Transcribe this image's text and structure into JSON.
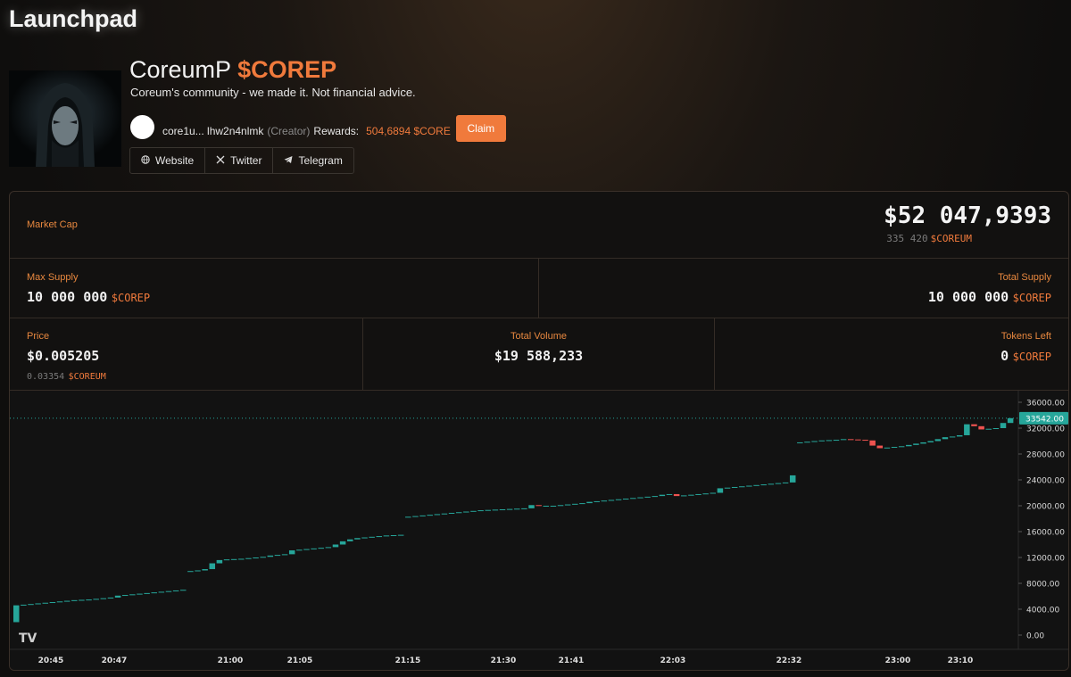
{
  "app": {
    "title": "Launchpad"
  },
  "token": {
    "name": "CoreumP",
    "ticker": "$COREP",
    "description": "Coreum's community - we made it. Not financial advice.",
    "creator_address": "core1u... lhw2n4nlmk",
    "creator_role": "(Creator)",
    "rewards_label": "Rewards:",
    "rewards_value": "504,6894 $CORE",
    "claim_label": "Claim"
  },
  "links": [
    {
      "label": "Website",
      "icon": "globe-icon"
    },
    {
      "label": "Twitter",
      "icon": "x-icon"
    },
    {
      "label": "Telegram",
      "icon": "telegram-icon"
    }
  ],
  "stats": {
    "market_cap_label": "Market Cap",
    "market_cap_value": "$52 047,9393",
    "market_cap_core_amount": "335 420",
    "market_cap_core_unit": "$COREUM",
    "max_supply_label": "Max Supply",
    "max_supply_value": "10 000 000",
    "max_supply_unit": "$COREP",
    "total_supply_label": "Total Supply",
    "total_supply_value": "10 000 000",
    "total_supply_unit": "$COREP",
    "price_label": "Price",
    "price_value": "$0.005205",
    "price_core_amount": "0.03354",
    "price_core_unit": "$COREUM",
    "volume_label": "Total Volume",
    "volume_value": "$19 588,233",
    "tokens_left_label": "Tokens Left",
    "tokens_left_value": "0",
    "tokens_left_unit": "$COREP"
  },
  "colors": {
    "accent": "#f07a3c",
    "label": "#e8883f",
    "up": "#26a69a",
    "down": "#ef5350"
  },
  "chart_data": {
    "type": "candlestick",
    "x": [
      "20:45",
      "20:47",
      "21:00",
      "21:05",
      "21:15",
      "21:30",
      "21:41",
      "22:03",
      "22:32",
      "23:00",
      "23:10"
    ],
    "y_ticks": [
      "36000.00",
      "32000.00",
      "28000.00",
      "24000.00",
      "20000.00",
      "16000.00",
      "12000.00",
      "8000.00",
      "4000.00",
      "0.00"
    ],
    "ylim": [
      0,
      36000
    ],
    "last_price_label": "33542.00",
    "last_price": 33542,
    "watermark": "TV",
    "candles": [
      [
        2000,
        4600,
        "up"
      ],
      [
        4600,
        4700
      ],
      [
        4700,
        4800
      ],
      [
        4800,
        4900
      ],
      [
        4900,
        5000
      ],
      [
        5000,
        5100
      ],
      [
        5100,
        5200
      ],
      [
        5200,
        5300
      ],
      [
        5300,
        5400
      ],
      [
        5400,
        5450
      ],
      [
        5450,
        5500
      ],
      [
        5500,
        5600
      ],
      [
        5600,
        5700
      ],
      [
        5700,
        5800
      ],
      [
        5800,
        6100
      ],
      [
        6100,
        6200
      ],
      [
        6200,
        6300
      ],
      [
        6300,
        6400
      ],
      [
        6400,
        6500
      ],
      [
        6500,
        6600
      ],
      [
        6600,
        6700
      ],
      [
        6700,
        6800
      ],
      [
        6800,
        6900
      ],
      [
        6900,
        7000
      ],
      [
        9800,
        9900
      ],
      [
        9900,
        10000
      ],
      [
        10000,
        10200
      ],
      [
        10200,
        11100
      ],
      [
        11100,
        11600
      ],
      [
        11600,
        11700
      ],
      [
        11700,
        11750
      ],
      [
        11750,
        11800
      ],
      [
        11800,
        11900
      ],
      [
        11900,
        12000
      ],
      [
        12000,
        12100
      ],
      [
        12100,
        12300
      ],
      [
        12300,
        12400
      ],
      [
        12400,
        12500
      ],
      [
        12500,
        13100
      ],
      [
        13100,
        13200
      ],
      [
        13200,
        13300
      ],
      [
        13300,
        13400
      ],
      [
        13400,
        13500
      ],
      [
        13500,
        13600
      ],
      [
        13600,
        14000
      ],
      [
        14000,
        14500
      ],
      [
        14500,
        14800
      ],
      [
        14800,
        15000
      ],
      [
        15000,
        15100
      ],
      [
        15100,
        15200
      ],
      [
        15200,
        15300
      ],
      [
        15300,
        15400
      ],
      [
        15400,
        15450
      ],
      [
        15450,
        15500
      ],
      [
        18200,
        18300
      ],
      [
        18300,
        18400
      ],
      [
        18400,
        18500
      ],
      [
        18500,
        18600
      ],
      [
        18600,
        18700
      ],
      [
        18700,
        18800
      ],
      [
        18800,
        18900
      ],
      [
        18900,
        19000
      ],
      [
        19000,
        19100
      ],
      [
        19100,
        19200
      ],
      [
        19200,
        19300
      ],
      [
        19300,
        19350
      ],
      [
        19350,
        19400
      ],
      [
        19400,
        19450
      ],
      [
        19450,
        19500
      ],
      [
        19500,
        19550
      ],
      [
        19550,
        19600
      ],
      [
        19600,
        20100
      ],
      [
        20100,
        20000
      ],
      [
        20000,
        20000
      ],
      [
        20000,
        20000
      ],
      [
        20000,
        20100
      ],
      [
        20100,
        20200
      ],
      [
        20200,
        20300
      ],
      [
        20300,
        20400
      ],
      [
        20400,
        20600
      ],
      [
        20600,
        20700
      ],
      [
        20700,
        20800
      ],
      [
        20800,
        20900
      ],
      [
        20900,
        21000
      ],
      [
        21000,
        21100
      ],
      [
        21100,
        21200
      ],
      [
        21200,
        21300
      ],
      [
        21300,
        21400
      ],
      [
        21400,
        21500
      ],
      [
        21500,
        21700
      ],
      [
        21700,
        21800
      ],
      [
        21800,
        21500
      ],
      [
        21500,
        21600
      ],
      [
        21600,
        21700
      ],
      [
        21700,
        21800
      ],
      [
        21800,
        21900
      ],
      [
        21900,
        22000
      ],
      [
        22000,
        22700
      ],
      [
        22700,
        22800
      ],
      [
        22800,
        22900
      ],
      [
        22900,
        23000
      ],
      [
        23000,
        23100
      ],
      [
        23100,
        23200
      ],
      [
        23200,
        23300
      ],
      [
        23300,
        23400
      ],
      [
        23400,
        23500
      ],
      [
        23500,
        23600
      ],
      [
        23600,
        24700
      ],
      [
        29700,
        29800
      ],
      [
        29800,
        29900
      ],
      [
        29900,
        30000
      ],
      [
        30000,
        30100
      ],
      [
        30100,
        30150
      ],
      [
        30150,
        30200
      ],
      [
        30200,
        30300
      ],
      [
        30300,
        30250
      ],
      [
        30250,
        30200
      ],
      [
        30200,
        30100
      ],
      [
        30100,
        29300
      ],
      [
        29300,
        28900
      ],
      [
        28900,
        29000
      ],
      [
        29000,
        29100
      ],
      [
        29100,
        29200
      ],
      [
        29200,
        29400
      ],
      [
        29400,
        29600
      ],
      [
        29600,
        29800
      ],
      [
        29800,
        30000
      ],
      [
        30000,
        30300
      ],
      [
        30300,
        30600
      ],
      [
        30600,
        30700
      ],
      [
        30700,
        30900
      ],
      [
        30900,
        32600
      ],
      [
        32600,
        32300
      ],
      [
        32300,
        31800
      ],
      [
        31800,
        31900
      ],
      [
        31900,
        32000
      ],
      [
        32000,
        32800
      ],
      [
        32800,
        33542
      ]
    ]
  }
}
